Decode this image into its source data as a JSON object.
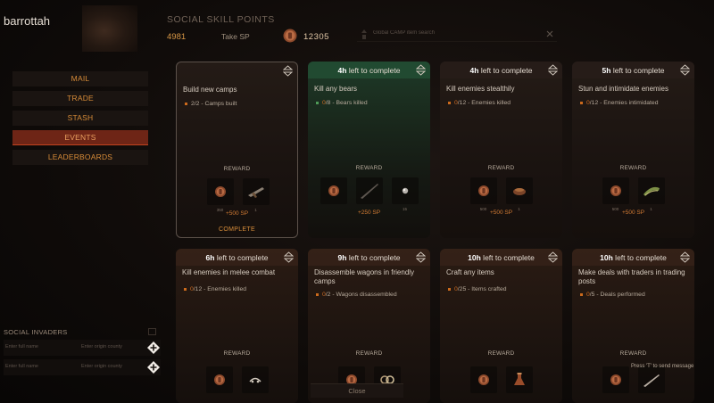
{
  "profile": {
    "name": "barrottah",
    "subtitle": ""
  },
  "nav": {
    "items": [
      {
        "label": "MAIL",
        "active": false
      },
      {
        "label": "TRADE",
        "active": false
      },
      {
        "label": "STASH",
        "active": false
      },
      {
        "label": "EVENTS",
        "active": true
      },
      {
        "label": "LEADERBOARDS",
        "active": false
      }
    ]
  },
  "invaders": {
    "title": "SOCIAL INVADERS",
    "rows": [
      {
        "name_placeholder": "Enter full name",
        "origin_placeholder": "Enter origin county"
      },
      {
        "name_placeholder": "Enter full name",
        "origin_placeholder": "Enter origin county"
      }
    ]
  },
  "topbar": {
    "title": "SOCIAL SKILL POINTS",
    "sp_value": "4981",
    "take_sp_label": "Take SP",
    "coin_count": "12305",
    "search_placeholder": "Global CAMP item search"
  },
  "cards": [
    {
      "header_bold": "",
      "header_text": "",
      "title": "Build new camps",
      "progress_num": "2/2",
      "progress_text": " - Camps built",
      "reward_label": "REWARD",
      "rewards": [
        {
          "icon": "coin-icon",
          "qty": "350"
        },
        {
          "icon": "rifle-icon",
          "qty": "1"
        }
      ],
      "sp_gain": "+500 SP",
      "status": "COMPLETE"
    },
    {
      "header_bold": "4h",
      "header_text": " left to complete",
      "title": "Kill any bears",
      "progress_num": "0",
      "progress_text": "/8 - Bears killed",
      "reward_label": "REWARD",
      "rewards": [
        {
          "icon": "coin-icon",
          "qty": ""
        },
        {
          "icon": "knife-icon",
          "qty": ""
        },
        {
          "icon": "orb-icon",
          "qty": "15"
        }
      ],
      "sp_gain": "+250 SP",
      "status": ""
    },
    {
      "header_bold": "4h",
      "header_text": " left to complete",
      "title": "Kill enemies stealthily",
      "progress_num": "0",
      "progress_text": "/12 - Enemies killed",
      "reward_label": "REWARD",
      "rewards": [
        {
          "icon": "coin-icon",
          "qty": "500"
        },
        {
          "icon": "pot-icon",
          "qty": "1"
        }
      ],
      "sp_gain": "+500 SP",
      "status": ""
    },
    {
      "header_bold": "5h",
      "header_text": " left to complete",
      "title": "Stun and intimidate enemies",
      "progress_num": "0",
      "progress_text": "/12 - Enemies intimidated",
      "reward_label": "REWARD",
      "rewards": [
        {
          "icon": "coin-icon",
          "qty": "500"
        },
        {
          "icon": "grenade-icon",
          "qty": "1"
        }
      ],
      "sp_gain": "+500 SP",
      "status": ""
    },
    {
      "header_bold": "6h",
      "header_text": " left to complete",
      "title": "Kill enemies in melee combat",
      "progress_num": "0",
      "progress_text": "/12 - Enemies killed",
      "reward_label": "REWARD",
      "rewards": [
        {
          "icon": "coin-icon",
          "qty": ""
        },
        {
          "icon": "bug-icon",
          "qty": ""
        }
      ],
      "sp_gain": "",
      "status": ""
    },
    {
      "header_bold": "9h",
      "header_text": " left to complete",
      "title": "Disassemble wagons in friendly camps",
      "progress_num": "0",
      "progress_text": "/2 - Wagons disassembled",
      "reward_label": "REWARD",
      "rewards": [
        {
          "icon": "coin-icon",
          "qty": ""
        },
        {
          "icon": "rings-icon",
          "qty": ""
        }
      ],
      "sp_gain": "",
      "status": ""
    },
    {
      "header_bold": "10h",
      "header_text": " left to complete",
      "title": "Craft any items",
      "progress_num": "0",
      "progress_text": "/25 - Items crafted",
      "reward_label": "REWARD",
      "rewards": [
        {
          "icon": "coin-icon",
          "qty": ""
        },
        {
          "icon": "flask-icon",
          "qty": ""
        }
      ],
      "sp_gain": "",
      "status": ""
    },
    {
      "header_bold": "10h",
      "header_text": " left to complete",
      "title": "Make deals with traders in trading posts",
      "progress_num": "0",
      "progress_text": "/5 - Deals performed",
      "reward_label": "REWARD",
      "rewards": [
        {
          "icon": "coin-icon",
          "qty": ""
        },
        {
          "icon": "blade-icon",
          "qty": ""
        }
      ],
      "sp_gain": "",
      "status": ""
    }
  ],
  "chat_hint": "Press 'T' to send message",
  "close_label": "Close",
  "colors": {
    "accent": "#d89846",
    "active_tab": "#6e2516",
    "green_header": "#214a31"
  }
}
